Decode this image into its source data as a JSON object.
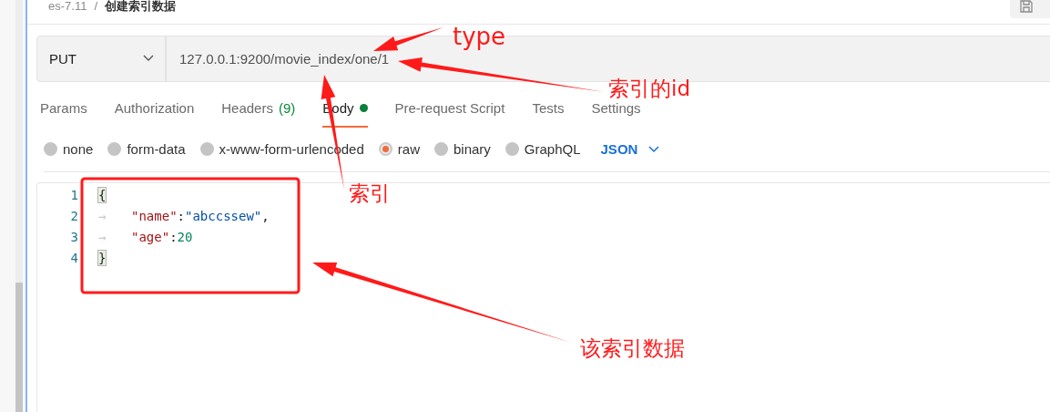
{
  "breadcrumb": {
    "collection": "es-7.11",
    "separator": "/",
    "request": "创建索引数据"
  },
  "request": {
    "method": "PUT",
    "url": "127.0.0.1:9200/movie_index/one/1"
  },
  "tabs": [
    {
      "label": "Params",
      "selected": false
    },
    {
      "label": "Authorization",
      "selected": false
    },
    {
      "label": "Headers",
      "count": "(9)",
      "selected": false
    },
    {
      "label": "Body",
      "selected": true,
      "has_content": true
    },
    {
      "label": "Pre-request Script",
      "selected": false
    },
    {
      "label": "Tests",
      "selected": false
    },
    {
      "label": "Settings",
      "selected": false
    }
  ],
  "body_types": [
    {
      "label": "none",
      "selected": false
    },
    {
      "label": "form-data",
      "selected": false
    },
    {
      "label": "x-www-form-urlencoded",
      "selected": false
    },
    {
      "label": "raw",
      "selected": true
    },
    {
      "label": "binary",
      "selected": false
    },
    {
      "label": "GraphQL",
      "selected": false
    }
  ],
  "raw_format": "JSON",
  "editor": {
    "lines": [
      {
        "number": "1",
        "tokens": [
          {
            "kind": "bracket",
            "text": "{"
          }
        ]
      },
      {
        "number": "2",
        "tokens": [
          {
            "kind": "tab",
            "text": "→"
          },
          {
            "kind": "key",
            "text": "\"name\""
          },
          {
            "kind": "punct",
            "text": ":"
          },
          {
            "kind": "string",
            "text": "\"abccssew\""
          },
          {
            "kind": "punct",
            "text": ","
          }
        ]
      },
      {
        "number": "3",
        "tokens": [
          {
            "kind": "tab",
            "text": "→"
          },
          {
            "kind": "key",
            "text": "\"age\""
          },
          {
            "kind": "punct",
            "text": ":"
          },
          {
            "kind": "number",
            "text": "20"
          }
        ]
      },
      {
        "number": "4",
        "tokens": [
          {
            "kind": "bracket",
            "text": "}"
          }
        ]
      }
    ]
  },
  "annotations": [
    {
      "kind": "arrow",
      "label": "type"
    },
    {
      "kind": "arrow",
      "label": "索引的id"
    },
    {
      "kind": "arrow",
      "label": "索引"
    },
    {
      "kind": "arrow",
      "label": "该索引数据"
    },
    {
      "kind": "box"
    }
  ]
}
